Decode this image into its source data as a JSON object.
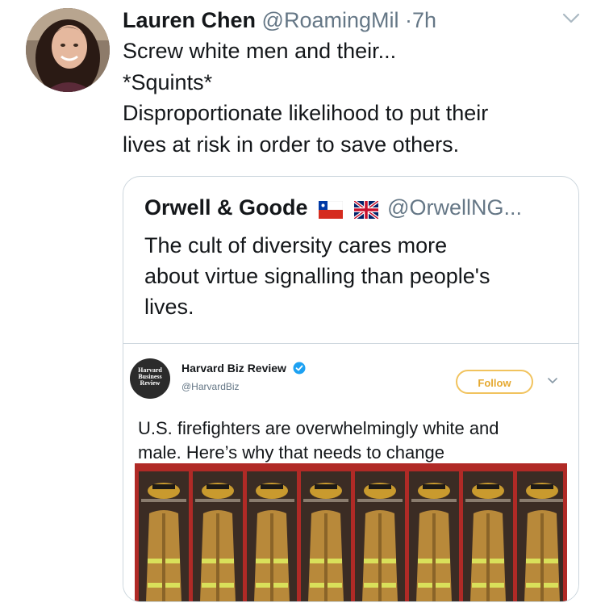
{
  "tweet": {
    "author_name": "Lauren Chen",
    "author_handle": "@RoamingMil",
    "separator": "·",
    "time": "7h",
    "lines": [
      "Screw white men and their...",
      "*Squints*",
      "Disproportionate likelihood to put their",
      "lives at risk in order to save others."
    ],
    "menu_icon": "chevron-down-icon"
  },
  "quote": {
    "author_name": "Orwell & Goode",
    "author_handle": "@OrwellNG...",
    "flags": [
      "chile-flag",
      "uk-flag"
    ],
    "lines": [
      "The cult of diversity cares more",
      "about virtue signalling than people's",
      "lives."
    ]
  },
  "embedded": {
    "logo_lines": [
      "Harvard",
      "Business",
      "Review"
    ],
    "author_name": "Harvard Biz Review",
    "author_handle": "@HarvardBiz",
    "follow_label": "Follow",
    "verified_icon": "verified-badge-icon",
    "lines": [
      "U.S. firefighters are overwhelmingly white and",
      "male. Here’s why that needs to change"
    ],
    "photo": "firefighter-gear-lockers-image"
  },
  "colors": {
    "text": "#14171a",
    "secondary": "#657786",
    "border": "#ccd6dd",
    "follow": "#e5a930",
    "verified": "#1da1f2",
    "locker_red": "#b02a26"
  }
}
